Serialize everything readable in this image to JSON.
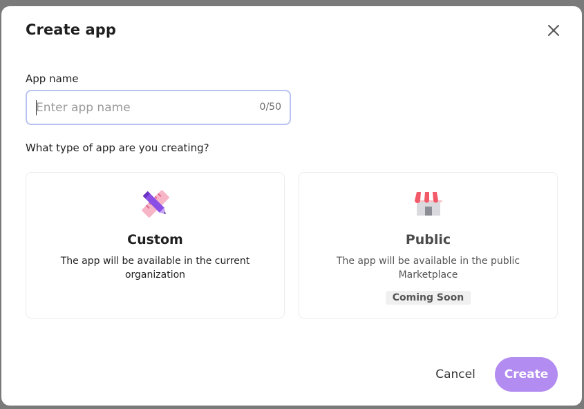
{
  "dialog": {
    "title": "Create app",
    "close_icon": "close-icon"
  },
  "app_name": {
    "label": "App name",
    "placeholder": "Enter app name",
    "value": "",
    "counter": "0/50"
  },
  "app_type": {
    "question": "What type of app are you creating?",
    "options": [
      {
        "title": "Custom",
        "description": "The app will be available in the current organization",
        "icon": "ruler-pencil-icon"
      },
      {
        "title": "Public",
        "description": "The app will be available in the public Marketplace",
        "badge": "Coming Soon",
        "icon": "storefront-icon"
      }
    ]
  },
  "footer": {
    "cancel_label": "Cancel",
    "create_label": "Create"
  },
  "colors": {
    "primary_disabled": "#b28cf0",
    "input_border_focus": "#b9c3f2",
    "backdrop": "#7a7a7a"
  }
}
